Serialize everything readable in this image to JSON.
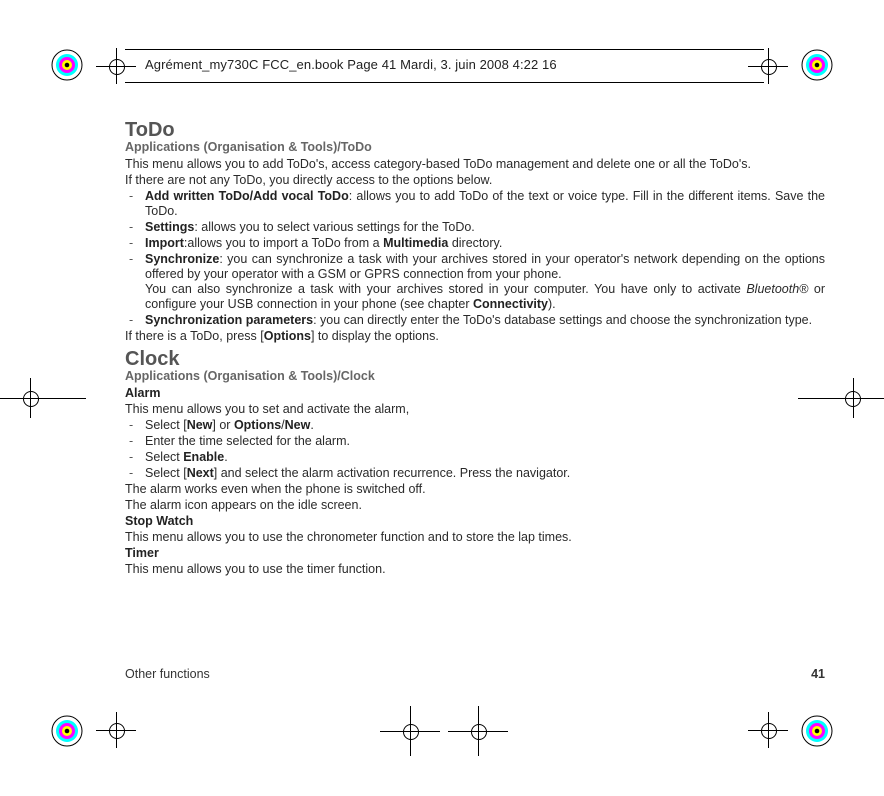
{
  "header": {
    "text": "Agrément_my730C FCC_en.book  Page 41  Mardi, 3. juin 2008  4:22 16"
  },
  "sections": {
    "todo": {
      "title": "ToDo",
      "breadcrumb": "Applications (Organisation & Tools)/ToDo",
      "intro1": "This menu allows you to add ToDo's, access category-based ToDo management and delete one or all the ToDo's.",
      "intro2": "If there are not any ToDo, you directly access to the options below.",
      "item_add_b": "Add written ToDo/Add vocal ToDo",
      "item_add_t": ": allows you to add ToDo of the text or voice type. Fill in the different items. Save the ToDo.",
      "item_set_b": "Settings",
      "item_set_t": ": allows you to select various settings for the ToDo.",
      "item_imp_b": "Import",
      "item_imp_t1": ":allows you to import a ToDo from a ",
      "item_imp_b2": "Multimedia",
      "item_imp_t2": " directory.",
      "item_syn_b": "Synchronize",
      "item_syn_t1": ": you can synchronize a task with your archives stored in your operator's network depending on the options offered by your operator with a GSM or GPRS connection from your phone.",
      "item_syn_t2a": "You can also synchronize a task with your archives stored in your computer. You have only to activate ",
      "item_syn_i": "Bluetooth®",
      "item_syn_t2b": " or configure your USB connection in your phone (see chapter ",
      "item_syn_b2": "Connectivity",
      "item_syn_t2c": ").",
      "item_sp_b": "Synchronization parameters",
      "item_sp_t": ": you can directly enter the ToDo's database settings and choose the synchronization type.",
      "outro_a": "If there is a ToDo, press [",
      "outro_b": "Options",
      "outro_c": "] to display the options."
    },
    "clock": {
      "title": "Clock",
      "breadcrumb": "Applications (Organisation & Tools)/Clock",
      "alarm_h": "Alarm",
      "alarm_p": "This menu allows you to set and activate the alarm,",
      "a1a": "Select [",
      "a1b": "New",
      "a1c": "] or ",
      "a1d": "Options",
      "a1e": "/",
      "a1f": "New",
      "a1g": ".",
      "a2": "Enter the time selected for the alarm.",
      "a3a": "Select ",
      "a3b": "Enable",
      "a3c": ".",
      "a4a": "Select [",
      "a4b": "Next",
      "a4c": "] and select the alarm activation recurrence. Press the navigator.",
      "alarm_p2": "The alarm works even when the phone is switched off.",
      "alarm_p3": "The alarm icon appears on the idle screen.",
      "stop_h": "Stop Watch",
      "stop_p": "This menu allows you to use the chronometer function and to store the lap times.",
      "timer_h": "Timer",
      "timer_p": "This menu allows you to use the timer function."
    }
  },
  "footer": {
    "left": "Other functions",
    "right": "41"
  }
}
